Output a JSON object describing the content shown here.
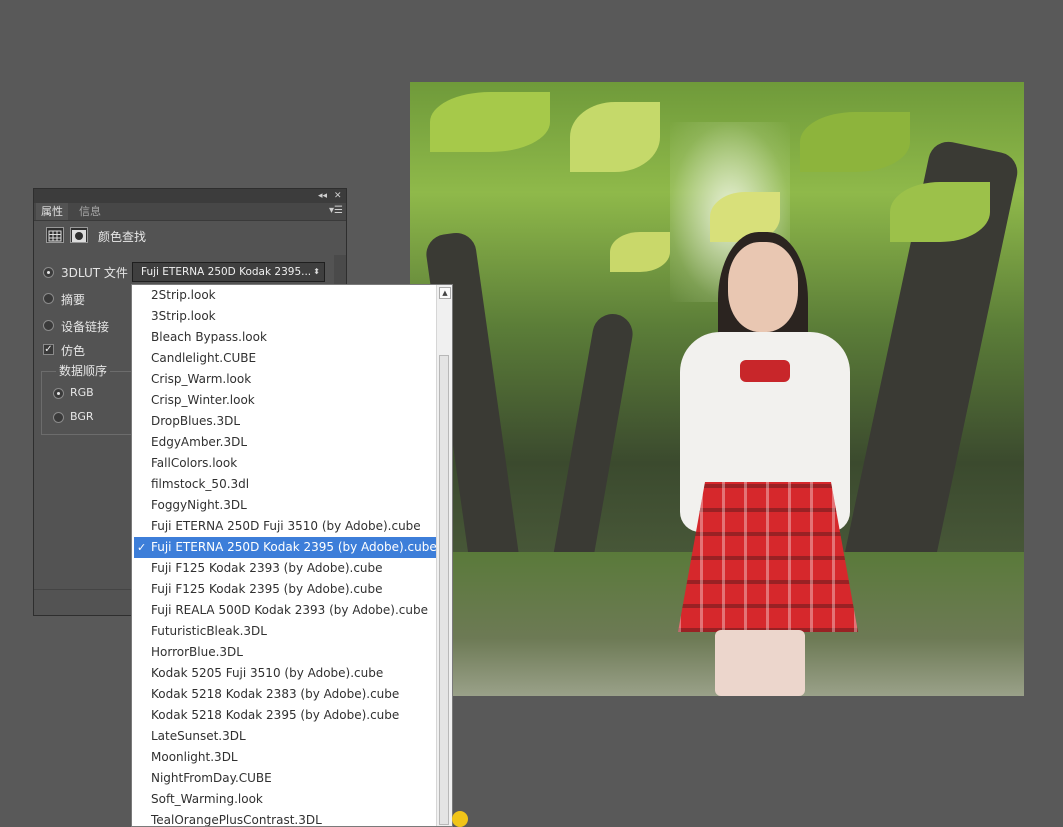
{
  "panel": {
    "tabs": [
      "属性",
      "信息"
    ],
    "title": "颜色查找",
    "options": {
      "lut_file_label": "3DLUT 文件",
      "abstract_label": "摘要",
      "device_link_label": "设备链接",
      "dither_label": "仿色",
      "dither_checked": true,
      "selected_radio": "3DLUT 文件"
    },
    "data_order": {
      "legend": "数据顺序",
      "rgb_label": "RGB",
      "bgr_label": "BGR",
      "selected": "RGB"
    },
    "lut_select_value": "Fuji ETERNA 250D Kodak 2395..."
  },
  "dropdown": {
    "items": [
      "2Strip.look",
      "3Strip.look",
      "Bleach Bypass.look",
      "Candlelight.CUBE",
      "Crisp_Warm.look",
      "Crisp_Winter.look",
      "DropBlues.3DL",
      "EdgyAmber.3DL",
      "FallColors.look",
      "filmstock_50.3dl",
      "FoggyNight.3DL",
      "Fuji ETERNA 250D Fuji 3510 (by Adobe).cube",
      "Fuji ETERNA 250D Kodak 2395 (by Adobe).cube",
      "Fuji F125 Kodak 2393 (by Adobe).cube",
      "Fuji F125 Kodak 2395 (by Adobe).cube",
      "Fuji REALA 500D Kodak 2393 (by Adobe).cube",
      "FuturisticBleak.3DL",
      "HorrorBlue.3DL",
      "Kodak 5205 Fuji 3510 (by Adobe).cube",
      "Kodak 5218 Kodak 2383 (by Adobe).cube",
      "Kodak 5218 Kodak 2395 (by Adobe).cube",
      "LateSunset.3DL",
      "Moonlight.3DL",
      "NightFromDay.CUBE",
      "Soft_Warming.look",
      "TealOrangePlusContrast.3DL"
    ],
    "selected_index": 12,
    "check_glyph": "✓"
  },
  "icons": {
    "collapse": "◂◂",
    "close": "✕",
    "panel_menu": "▾☰",
    "select_arrow": "⬍",
    "scroll_up": "▲",
    "checkmark": "✓"
  },
  "colors": {
    "workspace": "#595959",
    "panel": "#535353",
    "selection": "#3d7ed9"
  }
}
